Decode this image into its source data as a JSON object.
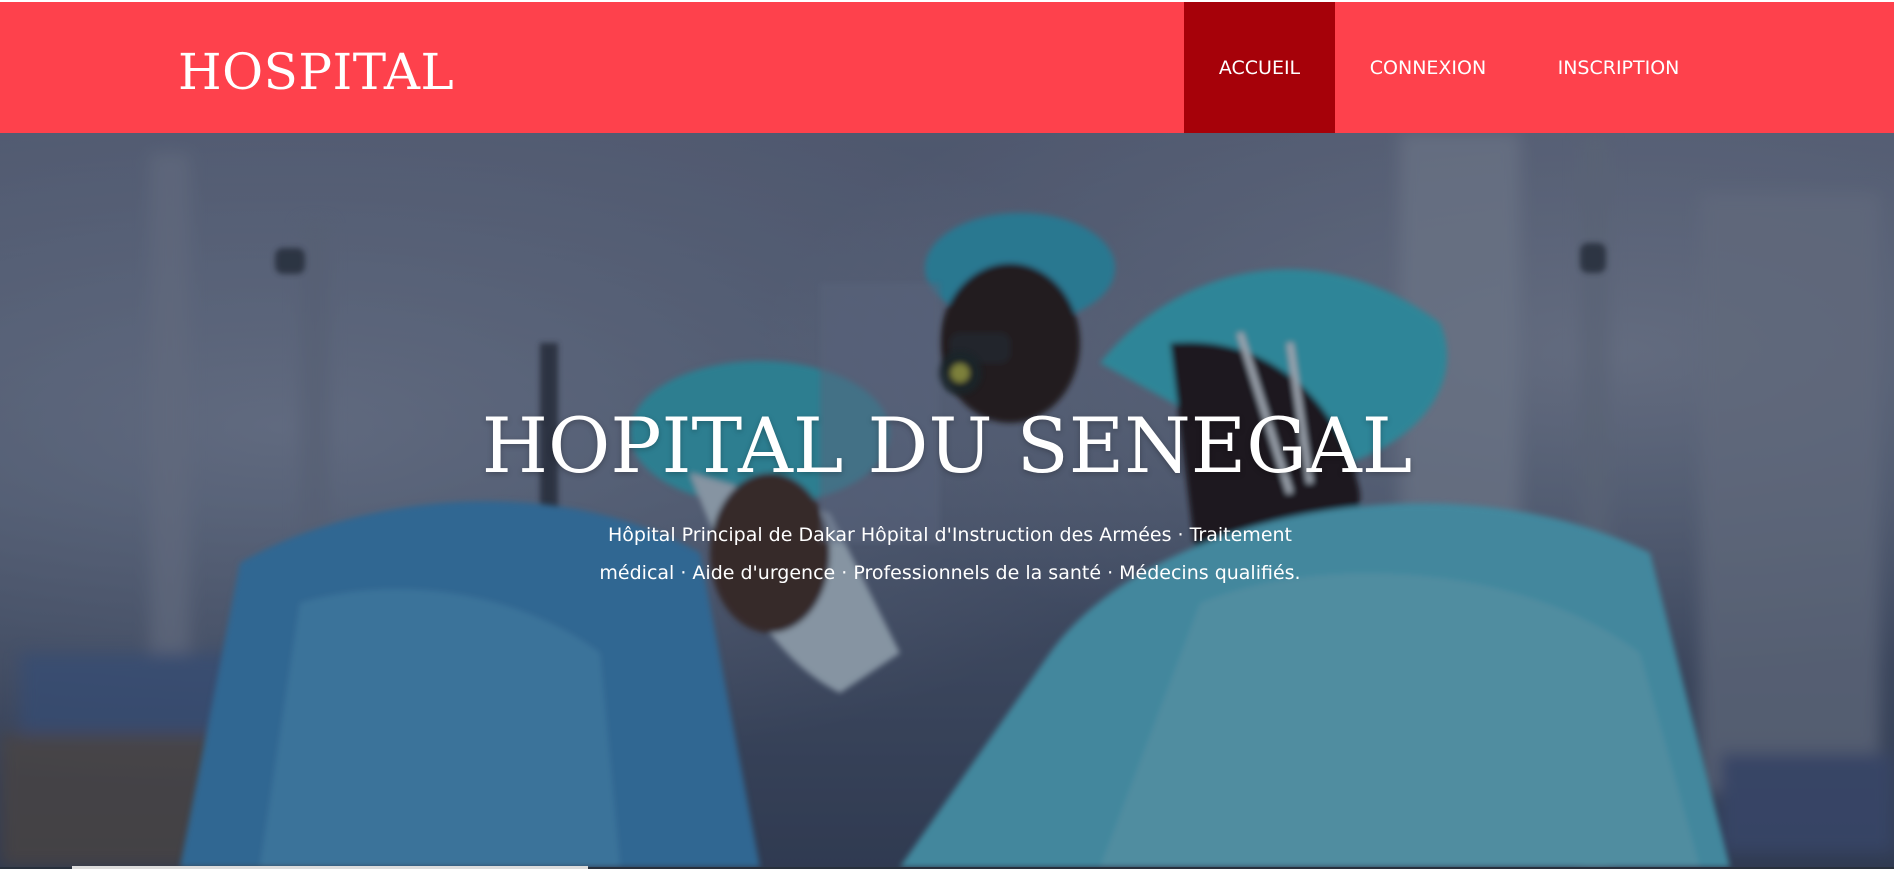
{
  "header": {
    "brand": "HOSPITAL",
    "nav": [
      {
        "label": "ACCUEIL",
        "active": true
      },
      {
        "label": "CONNEXION",
        "active": false
      },
      {
        "label": "INSCRIPTION",
        "active": false
      }
    ]
  },
  "hero": {
    "title": "HOPITAL DU SENEGAL",
    "description": "Hôpital Principal de Dakar Hôpital d'Instruction des Armées · Traitement médical · Aide d'urgence · Professionnels de la santé · Médecins qualifiés."
  },
  "colors": {
    "navbar": "#fe414c",
    "nav_active": "#a60109",
    "text": "#ffffff"
  }
}
